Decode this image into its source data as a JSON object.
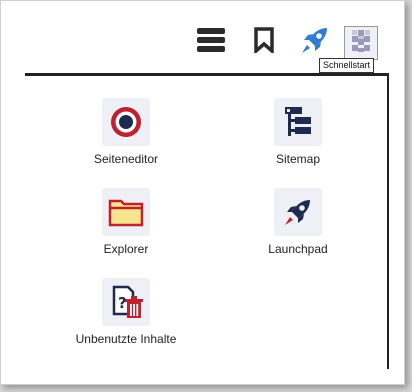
{
  "toolbar": {
    "hamburger_icon": "hamburger-menu-icon",
    "bookmark_icon": "bookmark-icon",
    "launch_icon": "rocket-icon",
    "avatar_icon": "user-avatar-icon",
    "tooltip": "Schnellstart"
  },
  "menu": {
    "items": [
      {
        "label": "Seiteneditor",
        "icon": "target-icon"
      },
      {
        "label": "Sitemap",
        "icon": "sitemap-icon"
      },
      {
        "label": "Explorer",
        "icon": "folder-icon"
      },
      {
        "label": "Launchpad",
        "icon": "rocket-icon"
      },
      {
        "label": "Unbenutzte Inhalte",
        "icon": "unused-content-icon"
      }
    ]
  },
  "colors": {
    "accent_red": "#c0212e",
    "navy": "#1c2b4f",
    "folder_yellow": "#f6e58d",
    "launch_blue": "#2f7dd1",
    "tile_bg": "#eef0f6"
  }
}
